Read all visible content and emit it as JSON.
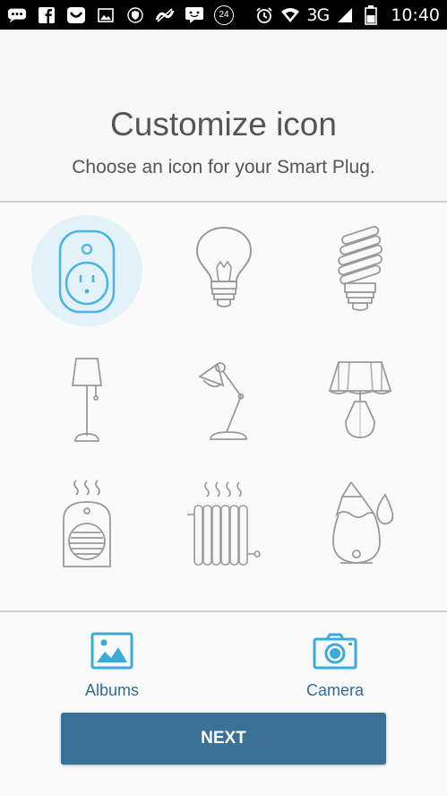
{
  "status_bar": {
    "network": "3G",
    "time": "10:40",
    "notification_badge": "24",
    "icons": [
      "chat-icon",
      "facebook-icon",
      "smile-app-icon",
      "image-icon",
      "shield-icon",
      "slash-app-icon",
      "message-icon",
      "badge-24-icon",
      "alarm-icon",
      "wifi-icon",
      "signal-icon",
      "battery-icon"
    ]
  },
  "header": {
    "title": "Customize icon",
    "subtitle": "Choose an icon for your Smart Plug."
  },
  "icon_grid": {
    "selected": "smart-plug",
    "accent": "#4bb4e0",
    "stroke": "#9a9a9a",
    "items": [
      "smart-plug-icon",
      "light-bulb-icon",
      "cfl-bulb-icon",
      "floor-lamp-icon",
      "desk-lamp-icon",
      "table-lamp-icon",
      "space-heater-icon",
      "radiator-icon",
      "humidifier-icon"
    ]
  },
  "actions": {
    "albums_label": "Albums",
    "camera_label": "Camera",
    "next_label": "NEXT",
    "accent": "#3aabd6",
    "button_color": "#3b7197"
  }
}
